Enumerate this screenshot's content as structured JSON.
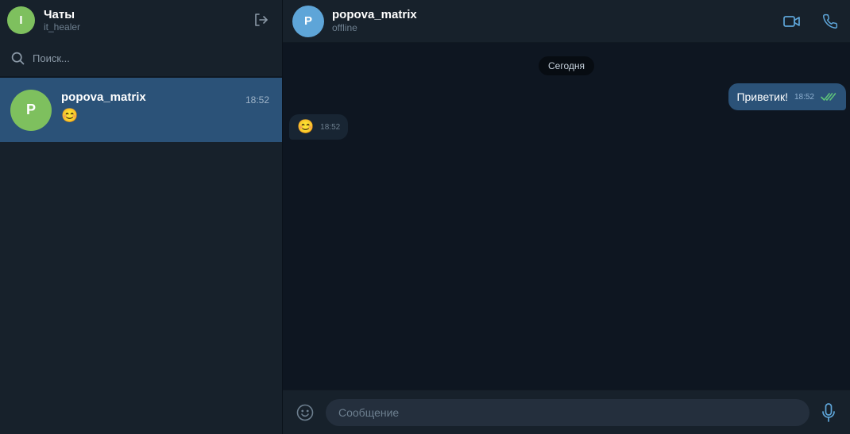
{
  "sidebar": {
    "header": {
      "avatar_letter": "I",
      "title": "Чаты",
      "subtitle": "it_healer",
      "logout_icon": "logout-icon"
    },
    "search": {
      "placeholder": "Поиск...",
      "icon": "search-icon"
    },
    "chats": [
      {
        "avatar_letter": "P",
        "name": "popova_matrix",
        "preview": "😊",
        "time": "18:52",
        "selected": true
      }
    ]
  },
  "chat": {
    "header": {
      "avatar_letter": "P",
      "name": "popova_matrix",
      "status": "offline",
      "video_icon": "video-call-icon",
      "phone_icon": "phone-icon"
    },
    "date_separator": "Сегодня",
    "messages": [
      {
        "direction": "out",
        "text": "Приветик!",
        "time": "18:52",
        "read": true
      },
      {
        "direction": "in",
        "text": "😊",
        "time": "18:52"
      }
    ],
    "composer": {
      "placeholder": "Сообщение",
      "emoji_icon": "emoji-icon",
      "mic_icon": "microphone-icon"
    }
  },
  "colors": {
    "sidebar_bg": "#17212b",
    "chat_bg": "#0e1621",
    "selected_chat": "#2b5278",
    "accent": "#5ea5d8",
    "avatar_green": "#7ec05e",
    "read_check": "#5ec27a"
  }
}
